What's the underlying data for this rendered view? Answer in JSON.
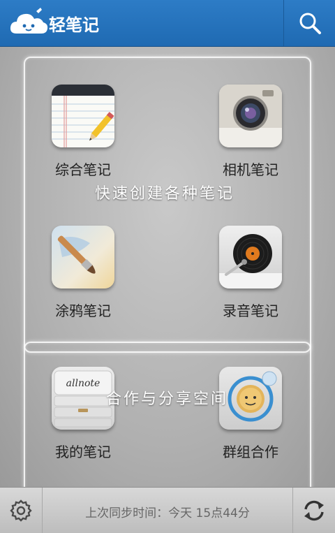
{
  "header": {
    "title": "轻笔记",
    "logo_icon": "cloud-logo-icon",
    "search_icon": "search-icon"
  },
  "panel1": {
    "caption": "快速创建各种笔记",
    "tiles": [
      {
        "label": "综合笔记",
        "icon": "notepad-icon"
      },
      {
        "label": "相机笔记",
        "icon": "camera-icon"
      },
      {
        "label": "涂鸦笔记",
        "icon": "paintbrush-icon"
      },
      {
        "label": "录音笔记",
        "icon": "record-player-icon"
      }
    ]
  },
  "panel2": {
    "caption": "合作与分享空间",
    "tiles": [
      {
        "label": "我的笔记",
        "icon": "notebook-stack-icon",
        "icon_text": "allnote"
      },
      {
        "label": "群组合作",
        "icon": "orbit-group-icon"
      }
    ]
  },
  "footer": {
    "sync_status": "上次同步时间：今天 15点44分",
    "settings_icon": "gear-icon",
    "sync_icon": "refresh-icon"
  },
  "colors": {
    "header": "#2d7cc6",
    "footer": "#d0d0d0",
    "accent_orange": "#e07a1e"
  }
}
